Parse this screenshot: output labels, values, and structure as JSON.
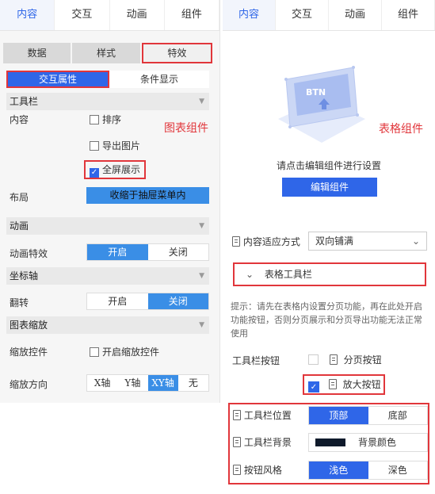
{
  "left": {
    "tabs": [
      "内容",
      "交互",
      "动画",
      "组件"
    ],
    "subtabs": [
      "数据",
      "样式",
      "特效"
    ],
    "subtabs2": [
      "交互属性",
      "条件显示"
    ],
    "toolbar_section": "工具栏",
    "content_label": "内容",
    "checkbox_sort": "排序",
    "checkbox_export": "导出图片",
    "checkbox_fullscreen": "全屏展示",
    "chart_component_note": "图表组件",
    "layout_label": "布局",
    "layout_value": "收缩于抽屉菜单内",
    "animation_section": "动画",
    "anim_effect_label": "动画特效",
    "anim_on": "开启",
    "anim_off": "关闭",
    "axis_section": "坐标轴",
    "flip_label": "翻转",
    "flip_on": "开启",
    "flip_off": "关闭",
    "zoom_section": "图表缩放",
    "zoom_control_label": "缩放控件",
    "zoom_control_checkbox": "开启缩放控件",
    "zoom_dir_label": "缩放方向",
    "zoom_dirs": [
      "X轴",
      "Y轴",
      "XY轴",
      "无"
    ]
  },
  "right": {
    "tabs": [
      "内容",
      "交互",
      "动画",
      "组件"
    ],
    "btn_illustration_text": "BTN",
    "table_component_note": "表格组件",
    "hint": "请点击编辑组件进行设置",
    "edit_button": "编辑组件",
    "fit_label": "内容适应方式",
    "fit_value": "双向铺满",
    "toolbar_section": "表格工具栏",
    "tip": "提示：请先在表格内设置分页功能，再在此处开启功能按钮，否则分页展示和分页导出功能无法正常使用",
    "toolbar_buttons_label": "工具栏按钮",
    "paging_button": "分页按钮",
    "zoom_button": "放大按钮",
    "toolbar_position_label": "工具栏位置",
    "pos_top": "顶部",
    "pos_bottom": "底部",
    "toolbar_bg_label": "工具栏背景",
    "bg_color_label": "背景颜色",
    "bg_color_swatch": "#0f1a2b",
    "button_style_label": "按钮风格",
    "style_light": "浅色",
    "style_dark": "深色"
  },
  "colors": {
    "accent": "#2f66e8",
    "highlight": "#e1363b"
  }
}
